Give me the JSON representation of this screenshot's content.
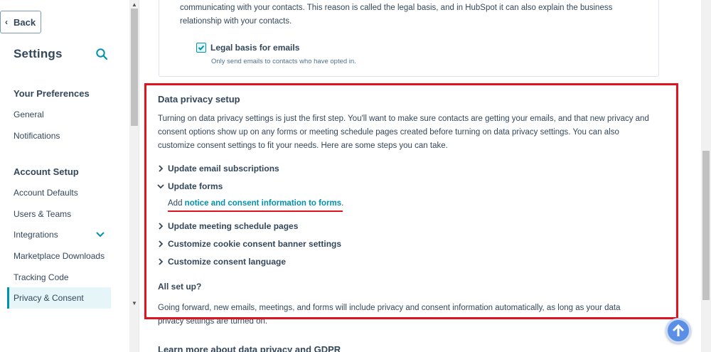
{
  "sidebar": {
    "back_label": "Back",
    "title": "Settings",
    "sections": [
      {
        "heading": "Your Preferences",
        "items": [
          "General",
          "Notifications"
        ]
      },
      {
        "heading": "Account Setup",
        "items": [
          "Account Defaults",
          "Users & Teams",
          "Integrations",
          "Marketplace Downloads",
          "Tracking Code",
          "Privacy & Consent"
        ]
      }
    ],
    "active_item": "Privacy & Consent"
  },
  "legal_basis": {
    "text": "communicating with your contacts. This reason is called the legal basis, and in HubSpot it can also explain the business relationship with your contacts.",
    "checkbox_label": "Legal basis for emails",
    "checkbox_checked": true,
    "checkbox_help": "Only send emails to contacts who have opted in."
  },
  "data_privacy": {
    "title": "Data privacy setup",
    "intro": "Turning on data privacy settings is just the first step. You'll want to make sure contacts are getting your emails, and that new privacy and consent options show up on any forms or meeting schedule pages created before turning on data privacy settings. You can also customize consent settings to fit your needs. Here are some steps you can take.",
    "steps": [
      {
        "label": "Update email subscriptions",
        "expanded": false
      },
      {
        "label": "Update forms",
        "expanded": true
      },
      {
        "label": "Update meeting schedule pages",
        "expanded": false
      },
      {
        "label": "Customize cookie consent banner settings",
        "expanded": false
      },
      {
        "label": "Customize consent language",
        "expanded": false
      }
    ],
    "forms_prefix": "Add ",
    "forms_link": "notice and consent information to forms",
    "forms_suffix": ".",
    "all_set_title": "All set up?",
    "all_set_text": "Going forward, new emails, meetings, and forms will include privacy and consent information automatically, as long as your data privacy settings are turned on."
  },
  "learn_more_title": "Learn more about data privacy and GDPR",
  "colors": {
    "accent": "#0091ae",
    "highlight": "#e0141e",
    "text": "#33475b"
  }
}
